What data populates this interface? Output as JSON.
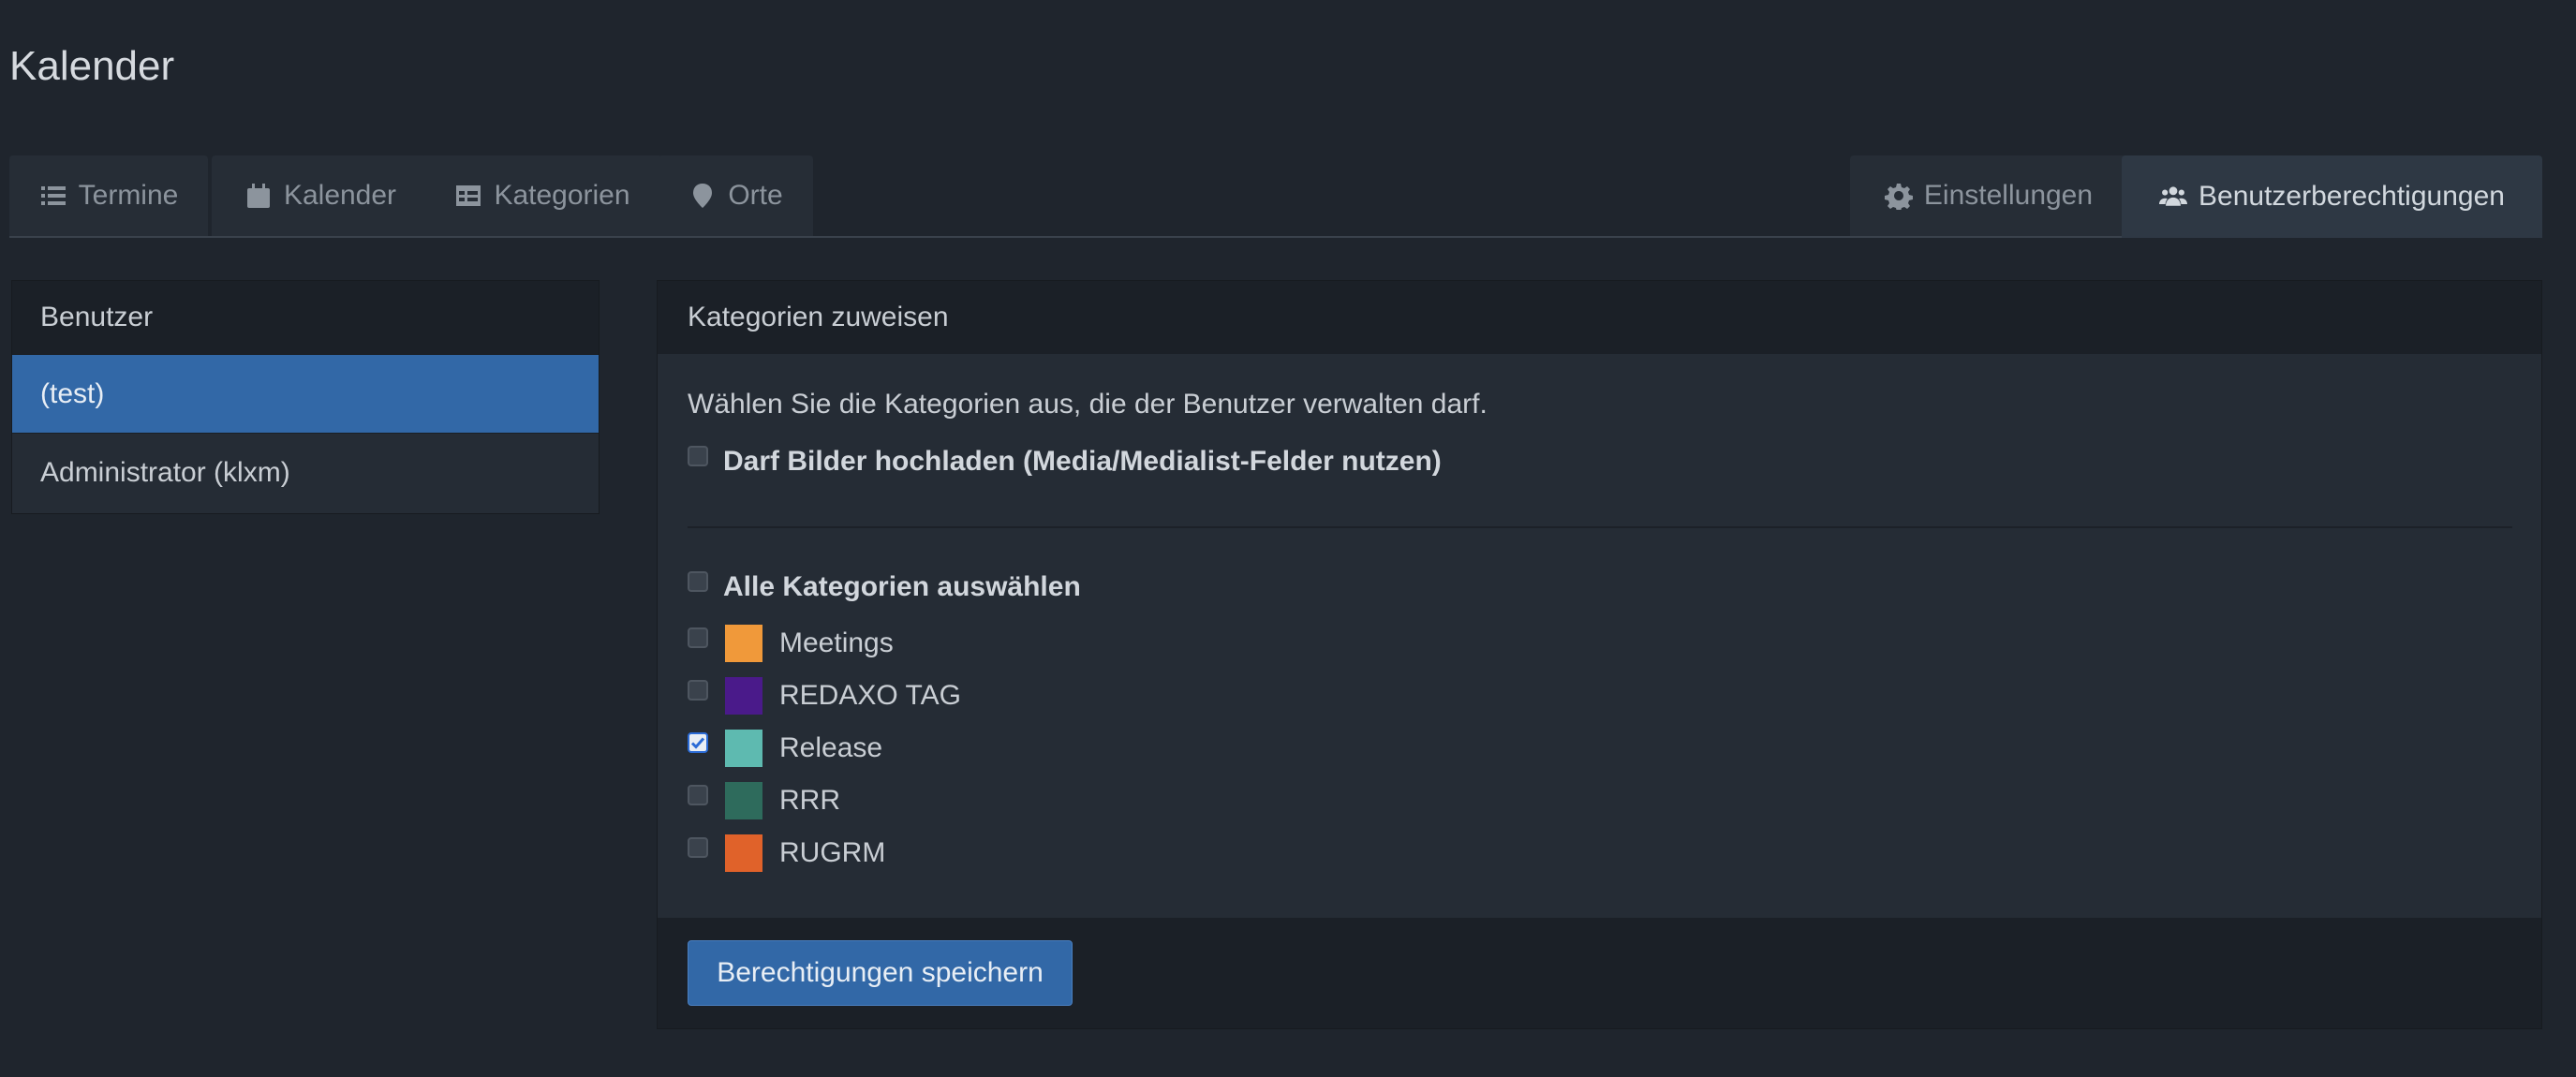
{
  "page": {
    "title": "Kalender"
  },
  "tabs": {
    "termine": "Termine",
    "kalender": "Kalender",
    "kategorien": "Kategorien",
    "orte": "Orte",
    "einstellungen": "Einstellungen",
    "benutzerberechtigungen": "Benutzerberechtigungen",
    "active": "Benutzerberechtigungen"
  },
  "users_panel": {
    "header": "Benutzer",
    "items": [
      {
        "label": "(test)",
        "selected": true
      },
      {
        "label": "Administrator (klxm)",
        "selected": false
      }
    ]
  },
  "permissions_panel": {
    "header": "Kategorien zuweisen",
    "intro": "Wählen Sie die Kategorien aus, die der Benutzer verwalten darf.",
    "media_option": {
      "label": "Darf Bilder hochladen (Media/Medialist-Felder nutzen)",
      "checked": false
    },
    "select_all": {
      "label": "Alle Kategorien auswählen",
      "checked": false
    },
    "categories": [
      {
        "label": "Meetings",
        "color": "#f0993a",
        "checked": false
      },
      {
        "label": "REDAXO TAG",
        "color": "#4a1a8a",
        "checked": false
      },
      {
        "label": "Release",
        "color": "#5ebab0",
        "checked": true
      },
      {
        "label": "RRR",
        "color": "#2e6b5c",
        "checked": false
      },
      {
        "label": "RUGRM",
        "color": "#e0622a",
        "checked": false
      }
    ],
    "save_button": "Berechtigungen speichern"
  },
  "colors": {
    "accent": "#3268a7",
    "background": "#1f252d"
  }
}
